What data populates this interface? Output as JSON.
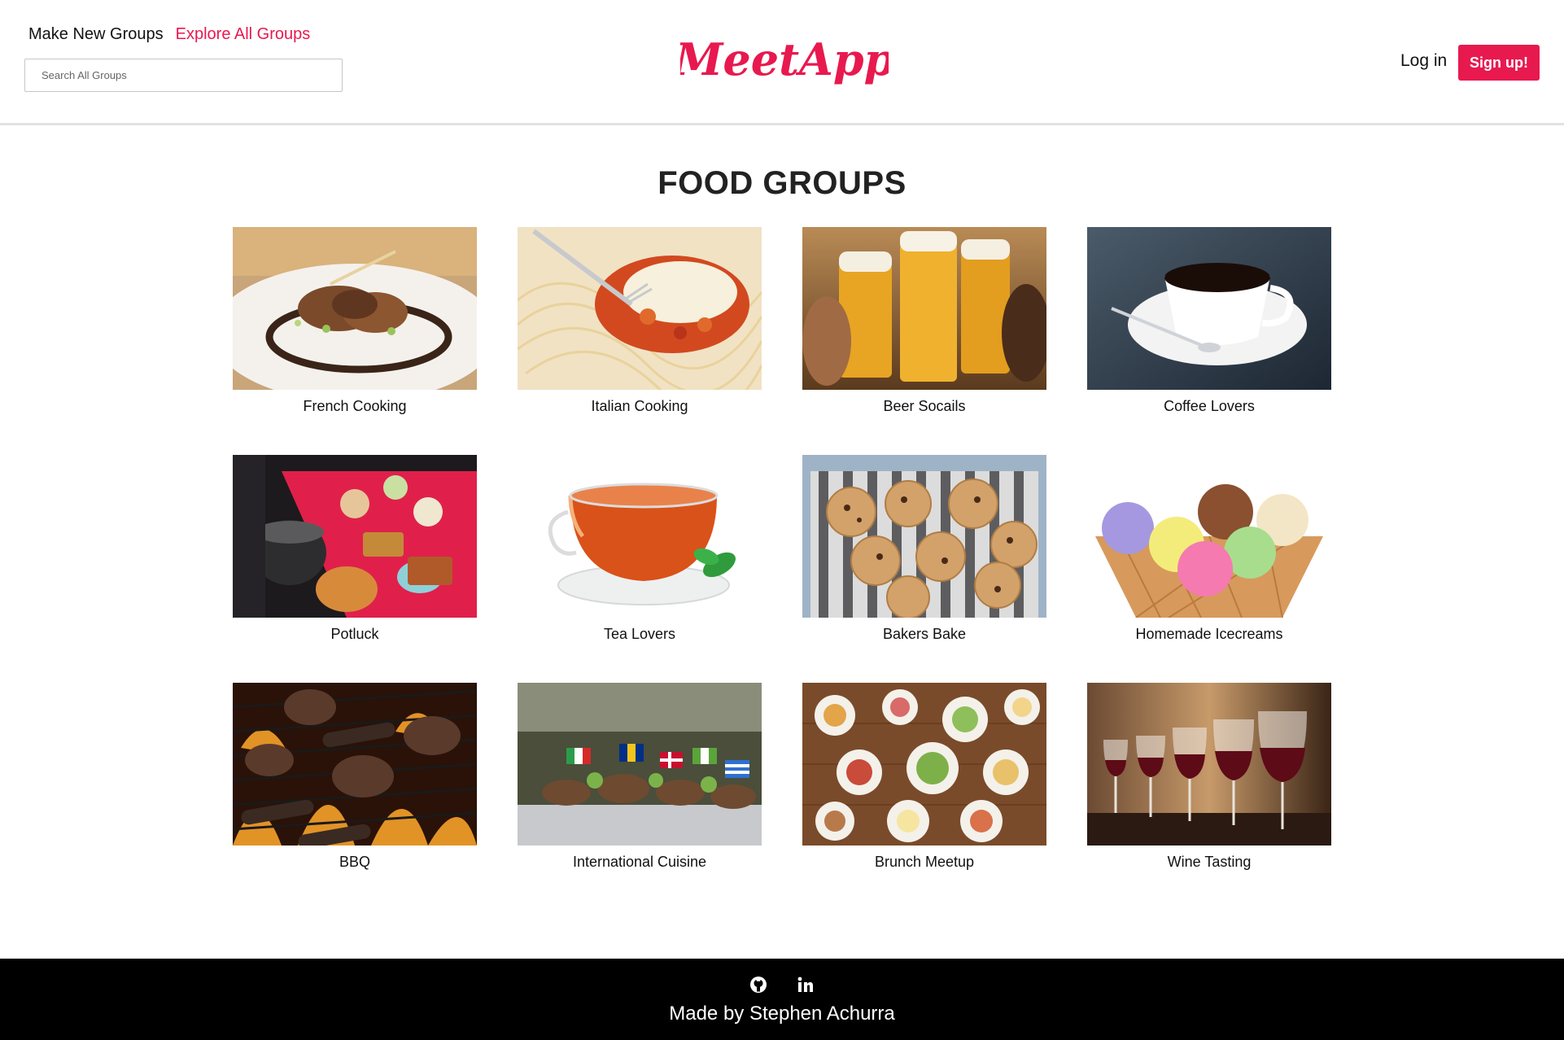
{
  "header": {
    "nav": {
      "make_new_groups": "Make New Groups",
      "explore_all_groups": "Explore All Groups"
    },
    "search": {
      "placeholder": "Search All Groups",
      "value": ""
    },
    "logo_text": "MeetApp",
    "login_label": "Log in",
    "signup_label": "Sign up!",
    "accent_color": "#e8194f"
  },
  "main": {
    "title": "FOOD GROUPS",
    "groups": [
      {
        "label": "French Cooking",
        "image": "plated-french-dish"
      },
      {
        "label": "Italian Cooking",
        "image": "spaghetti-with-cheese"
      },
      {
        "label": "Beer Socails",
        "image": "beer-mugs-toast"
      },
      {
        "label": "Coffee Lovers",
        "image": "coffee-cup-saucer"
      },
      {
        "label": "Potluck",
        "image": "potluck-buffet-table"
      },
      {
        "label": "Tea Lovers",
        "image": "glass-tea-cup-mint"
      },
      {
        "label": "Bakers Bake",
        "image": "cookies-on-striped-tray"
      },
      {
        "label": "Homemade Icecreams",
        "image": "ice-cream-scoops-cone"
      },
      {
        "label": "BBQ",
        "image": "burgers-on-grill"
      },
      {
        "label": "International Cuisine",
        "image": "buffet-with-flags"
      },
      {
        "label": "Brunch Meetup",
        "image": "brunch-table-top-view"
      },
      {
        "label": "Wine Tasting",
        "image": "row-of-wine-glasses"
      }
    ]
  },
  "footer": {
    "icons": [
      "github-icon",
      "linkedin-icon"
    ],
    "credit": "Made by Stephen Achurra"
  }
}
